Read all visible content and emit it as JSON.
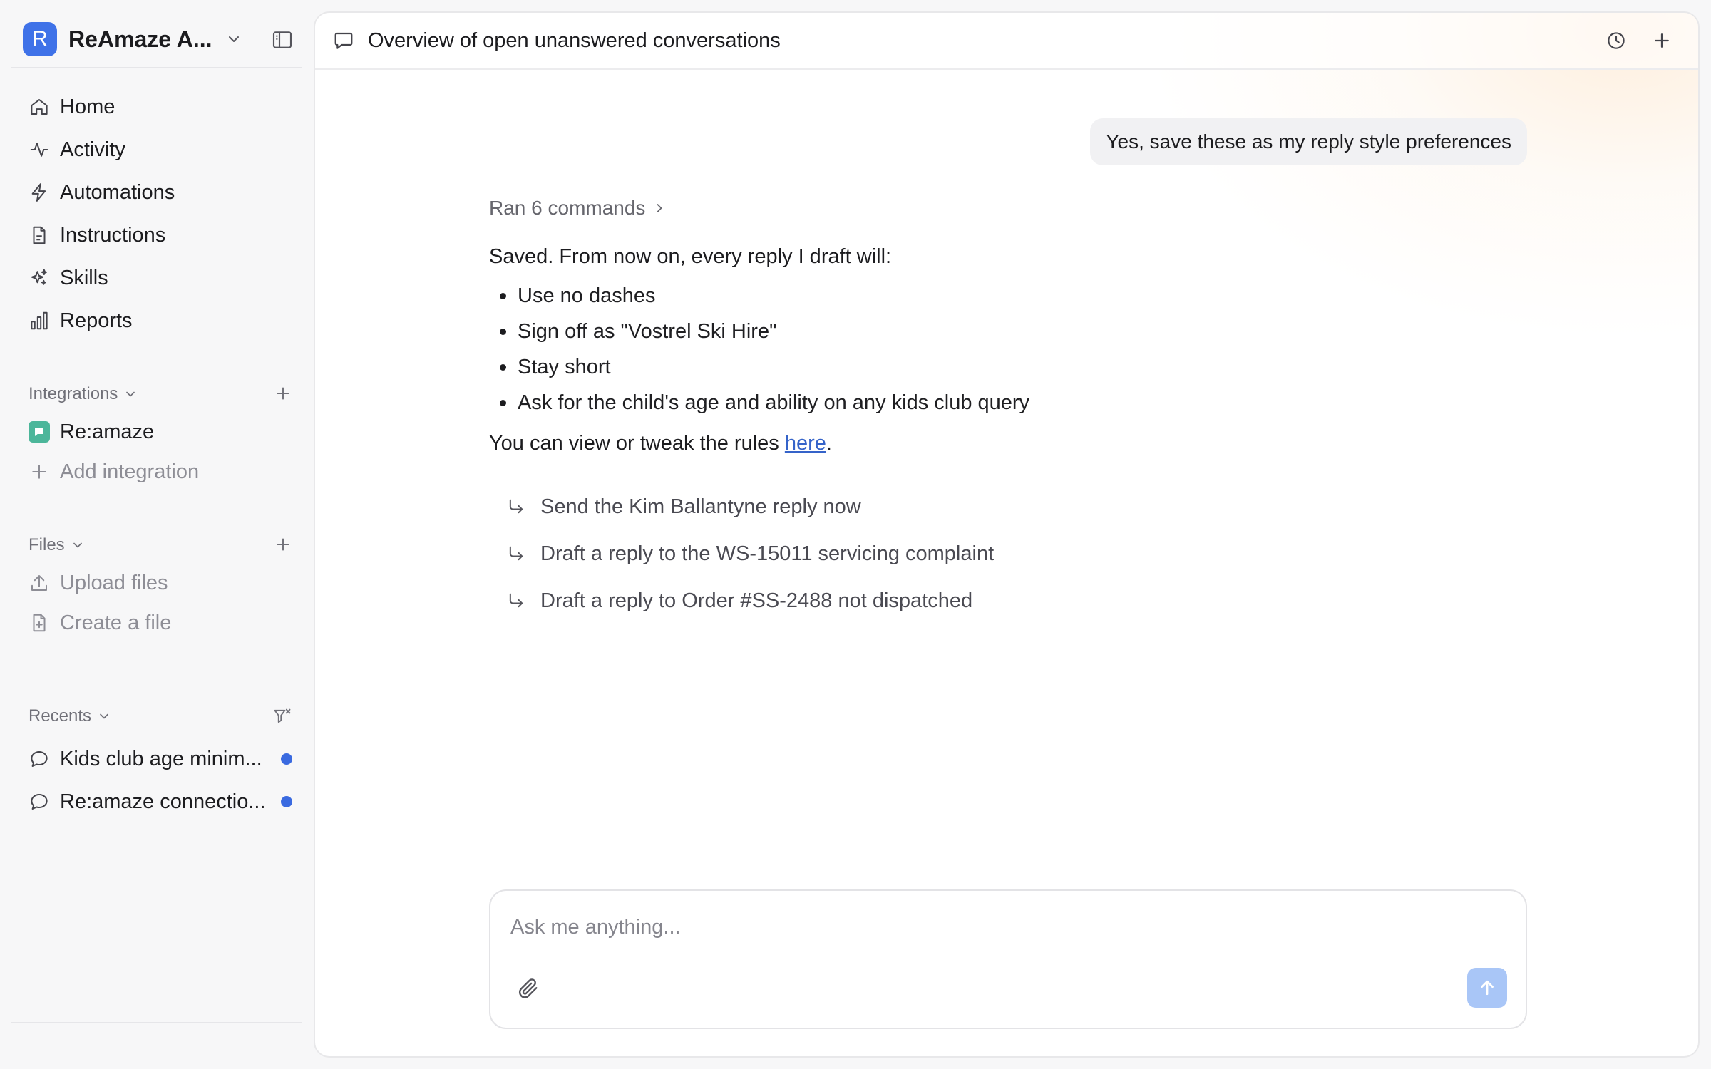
{
  "workspace": {
    "initial": "R",
    "name": "ReAmaze A..."
  },
  "nav": [
    {
      "label": "Home",
      "icon": "home-icon"
    },
    {
      "label": "Activity",
      "icon": "activity-icon"
    },
    {
      "label": "Automations",
      "icon": "lightning-icon"
    },
    {
      "label": "Instructions",
      "icon": "document-icon"
    },
    {
      "label": "Skills",
      "icon": "sparkle-icon"
    },
    {
      "label": "Reports",
      "icon": "bar-chart-icon"
    }
  ],
  "integrations": {
    "title": "Integrations",
    "items": [
      {
        "label": "Re:amaze",
        "icon": "reamaze-logo-icon"
      }
    ],
    "add_label": "Add integration"
  },
  "files": {
    "title": "Files",
    "upload_label": "Upload files",
    "create_label": "Create a file"
  },
  "recents": {
    "title": "Recents",
    "items": [
      {
        "label": "Kids club age minim...",
        "unread": true
      },
      {
        "label": "Re:amaze connectio...",
        "unread": true
      }
    ]
  },
  "conversation": {
    "title": "Overview of open unanswered conversations",
    "user_message": "Yes, save these as my reply style preferences",
    "commands_label": "Ran 6 commands",
    "reply_intro": "Saved. From now on, every reply I draft will:",
    "reply_bullets": [
      "Use no dashes",
      "Sign off as \"Vostrel Ski Hire\"",
      "Stay short",
      "Ask for the child's age and ability on any kids club query"
    ],
    "reply_outro_prefix": "You can view or tweak the rules ",
    "reply_outro_link": "here",
    "reply_outro_suffix": ".",
    "suggestions": [
      "Send the Kim Ballantyne reply now",
      "Draft a reply to the WS-15011 servicing complaint",
      "Draft a reply to Order #SS-2488 not dispatched"
    ]
  },
  "composer": {
    "placeholder": "Ask me anything..."
  },
  "colors": {
    "accent": "#3f72e8",
    "unread_dot": "#3a6ae0",
    "reamaze_logo": "#4cb69a",
    "send_button_disabled": "#a9c6f7",
    "link": "#3563c9"
  }
}
